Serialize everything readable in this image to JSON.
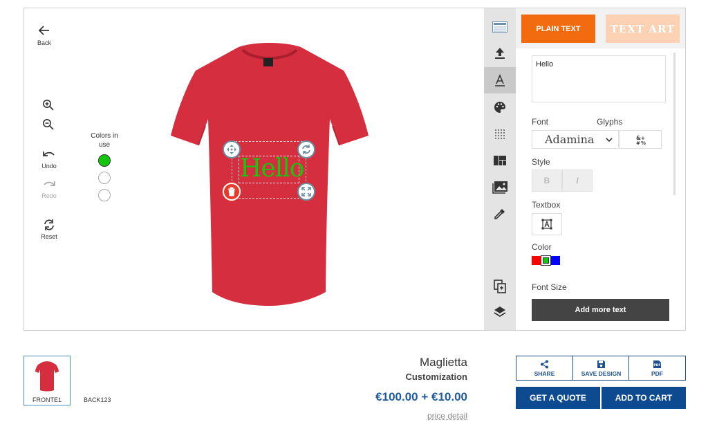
{
  "toolbar": {
    "back_label": "Back",
    "undo_label": "Undo",
    "redo_label": "Redo",
    "reset_label": "Reset"
  },
  "colors_in_use": {
    "label": "Colors in use",
    "swatches": [
      "#16c60c",
      "#ffffff",
      "#ffffff"
    ]
  },
  "design": {
    "text": "Hello",
    "text_color": "#16c60c",
    "shirt_color": "#d42e3f"
  },
  "panel": {
    "plain_text_label": "PLAIN TEXT",
    "text_art_label": "TEXT ART",
    "text_value": "Hello",
    "font_label": "Font",
    "glyphs_label": "Glyphs",
    "font_value": "Adamina",
    "style_label": "Style",
    "bold_label": "B",
    "italic_label": "I",
    "textbox_label": "Textbox",
    "color_label": "Color",
    "colors": [
      "#ff0000",
      "#16c60c",
      "#0000ff"
    ],
    "font_size_label": "Font Size",
    "add_more_label": "Add more text"
  },
  "views": {
    "front_label": "FRONTE1",
    "back_label": "BACK123"
  },
  "product": {
    "name": "Maglietta",
    "subtitle": "Customization",
    "price": "€100.00 + €10.00",
    "price_detail_label": "price detail"
  },
  "actions": {
    "share_label": "SHARE",
    "save_label": "SAVE DESIGN",
    "pdf_label": "PDF",
    "quote_label": "GET A QUOTE",
    "cart_label": "ADD TO CART"
  },
  "accent_color": "#f26b0f",
  "primary_color": "#0d4a8f"
}
